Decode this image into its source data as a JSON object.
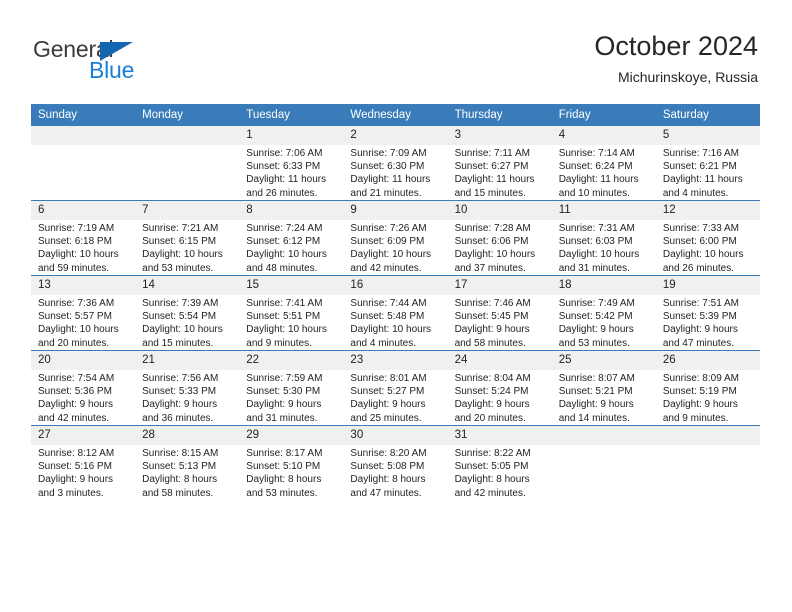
{
  "brand": {
    "name_part1": "General",
    "name_part2": "Blue",
    "accent_color": "#1a7fd4",
    "triangle_color": "#1565b0"
  },
  "header": {
    "title": "October 2024",
    "location": "Michurinskoye, Russia",
    "header_bg_color": "#3a7cb9"
  },
  "calendar": {
    "weekday_headers": [
      "Sunday",
      "Monday",
      "Tuesday",
      "Wednesday",
      "Thursday",
      "Friday",
      "Saturday"
    ],
    "labels": {
      "sunrise": "Sunrise:",
      "sunset": "Sunset:",
      "daylight": "Daylight:"
    },
    "weeks": [
      [
        {
          "day": "",
          "empty": true
        },
        {
          "day": "",
          "empty": true
        },
        {
          "day": "1",
          "sunrise": "Sunrise: 7:06 AM",
          "sunset": "Sunset: 6:33 PM",
          "daylight": "Daylight: 11 hours and 26 minutes."
        },
        {
          "day": "2",
          "sunrise": "Sunrise: 7:09 AM",
          "sunset": "Sunset: 6:30 PM",
          "daylight": "Daylight: 11 hours and 21 minutes."
        },
        {
          "day": "3",
          "sunrise": "Sunrise: 7:11 AM",
          "sunset": "Sunset: 6:27 PM",
          "daylight": "Daylight: 11 hours and 15 minutes."
        },
        {
          "day": "4",
          "sunrise": "Sunrise: 7:14 AM",
          "sunset": "Sunset: 6:24 PM",
          "daylight": "Daylight: 11 hours and 10 minutes."
        },
        {
          "day": "5",
          "sunrise": "Sunrise: 7:16 AM",
          "sunset": "Sunset: 6:21 PM",
          "daylight": "Daylight: 11 hours and 4 minutes."
        }
      ],
      [
        {
          "day": "6",
          "sunrise": "Sunrise: 7:19 AM",
          "sunset": "Sunset: 6:18 PM",
          "daylight": "Daylight: 10 hours and 59 minutes."
        },
        {
          "day": "7",
          "sunrise": "Sunrise: 7:21 AM",
          "sunset": "Sunset: 6:15 PM",
          "daylight": "Daylight: 10 hours and 53 minutes."
        },
        {
          "day": "8",
          "sunrise": "Sunrise: 7:24 AM",
          "sunset": "Sunset: 6:12 PM",
          "daylight": "Daylight: 10 hours and 48 minutes."
        },
        {
          "day": "9",
          "sunrise": "Sunrise: 7:26 AM",
          "sunset": "Sunset: 6:09 PM",
          "daylight": "Daylight: 10 hours and 42 minutes."
        },
        {
          "day": "10",
          "sunrise": "Sunrise: 7:28 AM",
          "sunset": "Sunset: 6:06 PM",
          "daylight": "Daylight: 10 hours and 37 minutes."
        },
        {
          "day": "11",
          "sunrise": "Sunrise: 7:31 AM",
          "sunset": "Sunset: 6:03 PM",
          "daylight": "Daylight: 10 hours and 31 minutes."
        },
        {
          "day": "12",
          "sunrise": "Sunrise: 7:33 AM",
          "sunset": "Sunset: 6:00 PM",
          "daylight": "Daylight: 10 hours and 26 minutes."
        }
      ],
      [
        {
          "day": "13",
          "sunrise": "Sunrise: 7:36 AM",
          "sunset": "Sunset: 5:57 PM",
          "daylight": "Daylight: 10 hours and 20 minutes."
        },
        {
          "day": "14",
          "sunrise": "Sunrise: 7:39 AM",
          "sunset": "Sunset: 5:54 PM",
          "daylight": "Daylight: 10 hours and 15 minutes."
        },
        {
          "day": "15",
          "sunrise": "Sunrise: 7:41 AM",
          "sunset": "Sunset: 5:51 PM",
          "daylight": "Daylight: 10 hours and 9 minutes."
        },
        {
          "day": "16",
          "sunrise": "Sunrise: 7:44 AM",
          "sunset": "Sunset: 5:48 PM",
          "daylight": "Daylight: 10 hours and 4 minutes."
        },
        {
          "day": "17",
          "sunrise": "Sunrise: 7:46 AM",
          "sunset": "Sunset: 5:45 PM",
          "daylight": "Daylight: 9 hours and 58 minutes."
        },
        {
          "day": "18",
          "sunrise": "Sunrise: 7:49 AM",
          "sunset": "Sunset: 5:42 PM",
          "daylight": "Daylight: 9 hours and 53 minutes."
        },
        {
          "day": "19",
          "sunrise": "Sunrise: 7:51 AM",
          "sunset": "Sunset: 5:39 PM",
          "daylight": "Daylight: 9 hours and 47 minutes."
        }
      ],
      [
        {
          "day": "20",
          "sunrise": "Sunrise: 7:54 AM",
          "sunset": "Sunset: 5:36 PM",
          "daylight": "Daylight: 9 hours and 42 minutes."
        },
        {
          "day": "21",
          "sunrise": "Sunrise: 7:56 AM",
          "sunset": "Sunset: 5:33 PM",
          "daylight": "Daylight: 9 hours and 36 minutes."
        },
        {
          "day": "22",
          "sunrise": "Sunrise: 7:59 AM",
          "sunset": "Sunset: 5:30 PM",
          "daylight": "Daylight: 9 hours and 31 minutes."
        },
        {
          "day": "23",
          "sunrise": "Sunrise: 8:01 AM",
          "sunset": "Sunset: 5:27 PM",
          "daylight": "Daylight: 9 hours and 25 minutes."
        },
        {
          "day": "24",
          "sunrise": "Sunrise: 8:04 AM",
          "sunset": "Sunset: 5:24 PM",
          "daylight": "Daylight: 9 hours and 20 minutes."
        },
        {
          "day": "25",
          "sunrise": "Sunrise: 8:07 AM",
          "sunset": "Sunset: 5:21 PM",
          "daylight": "Daylight: 9 hours and 14 minutes."
        },
        {
          "day": "26",
          "sunrise": "Sunrise: 8:09 AM",
          "sunset": "Sunset: 5:19 PM",
          "daylight": "Daylight: 9 hours and 9 minutes."
        }
      ],
      [
        {
          "day": "27",
          "sunrise": "Sunrise: 8:12 AM",
          "sunset": "Sunset: 5:16 PM",
          "daylight": "Daylight: 9 hours and 3 minutes."
        },
        {
          "day": "28",
          "sunrise": "Sunrise: 8:15 AM",
          "sunset": "Sunset: 5:13 PM",
          "daylight": "Daylight: 8 hours and 58 minutes."
        },
        {
          "day": "29",
          "sunrise": "Sunrise: 8:17 AM",
          "sunset": "Sunset: 5:10 PM",
          "daylight": "Daylight: 8 hours and 53 minutes."
        },
        {
          "day": "30",
          "sunrise": "Sunrise: 8:20 AM",
          "sunset": "Sunset: 5:08 PM",
          "daylight": "Daylight: 8 hours and 47 minutes."
        },
        {
          "day": "31",
          "sunrise": "Sunrise: 8:22 AM",
          "sunset": "Sunset: 5:05 PM",
          "daylight": "Daylight: 8 hours and 42 minutes."
        },
        {
          "day": "",
          "empty": true
        },
        {
          "day": "",
          "empty": true
        }
      ]
    ]
  }
}
